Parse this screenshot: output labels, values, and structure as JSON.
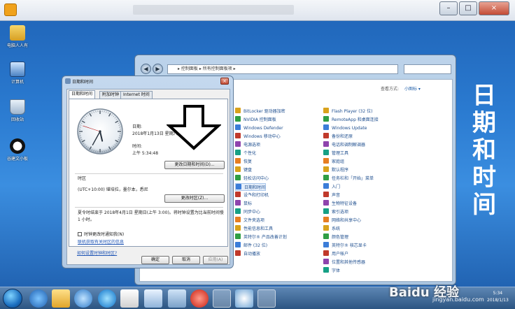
{
  "desktop": {
    "icons": [
      {
        "label": "电脑人人有",
        "icon": "folder-user-icon"
      },
      {
        "label": "计算机",
        "icon": "computer-icon"
      },
      {
        "label": "回收站",
        "icon": "recycle-bin-icon"
      },
      {
        "label": "谷建文小板",
        "icon": "panda-icon"
      }
    ]
  },
  "recorder": {
    "controls": [
      "–",
      "□",
      "×"
    ]
  },
  "control_panel": {
    "breadcrumb": "▸ 控制面板 ▸ 所有控制面板项 ▸",
    "view_by_label": "查看方式:",
    "view_by_value": "小图标 ▾",
    "left_items": [
      "BitLocker 驱动器加密",
      "NVIDIA 控制面板",
      "Windows Defender",
      "Windows 移动中心",
      "电源选项",
      "个性化",
      "恢复",
      "键盘",
      "轻松访问中心",
      "日期和时间",
      "设备和打印机",
      "鼠标",
      "同步中心",
      "文件夹选项",
      "性能信息和工具",
      "英特尔® 产品改善计划",
      "邮件 (32 位)",
      "自动播放"
    ],
    "right_items": [
      "Flash Player (32 位)",
      "RemoteApp 和桌面连接",
      "Windows Update",
      "备份和还原",
      "电话和调制解调器",
      "管理工具",
      "家庭组",
      "默认程序",
      "任务栏和「开始」菜单",
      "入门",
      "声音",
      "生物特征设备",
      "索引选项",
      "网络和共享中心",
      "系统",
      "颜色管理",
      "英特尔® 核芯显卡",
      "用户帐户",
      "位置和其他传感器",
      "字体"
    ]
  },
  "datetime_dialog": {
    "title": "日期和时间",
    "close": "×",
    "tabs": [
      "日期和时间",
      "附加时钟",
      "Internet 时间"
    ],
    "date_label": "日期:",
    "date_value": "2018年1月13日 星期六",
    "time_label": "时间:",
    "time_value": "上午 5:34:48",
    "change_datetime_button": "更改日期和时间(D)...",
    "timezone_label": "时区",
    "timezone_value": "(UTC+10:00) 堪培拉，墨尔本，悉尼",
    "change_timezone_button": "更改时区(Z)...",
    "dst_note": "夏令时结束于 2018年4月1日 星期日(上午 3:00)。将时钟设置为比当前时间慢 1 小时。",
    "notify_checkbox": "时钟更改时通知我(N)",
    "link_online": "联机获取有关时区的信息",
    "link_howto": "如何设置时钟和时区?",
    "ok_button": "确定",
    "cancel_button": "取消",
    "apply_button": "应用(A)"
  },
  "banner": {
    "chars": [
      "日",
      "期",
      "和",
      "时",
      "间"
    ]
  },
  "taskbar": {
    "time": "5:34",
    "date": "2018/1/13"
  },
  "watermark": {
    "text": "Baidu 经验",
    "url": "jingyan.baidu.com"
  }
}
